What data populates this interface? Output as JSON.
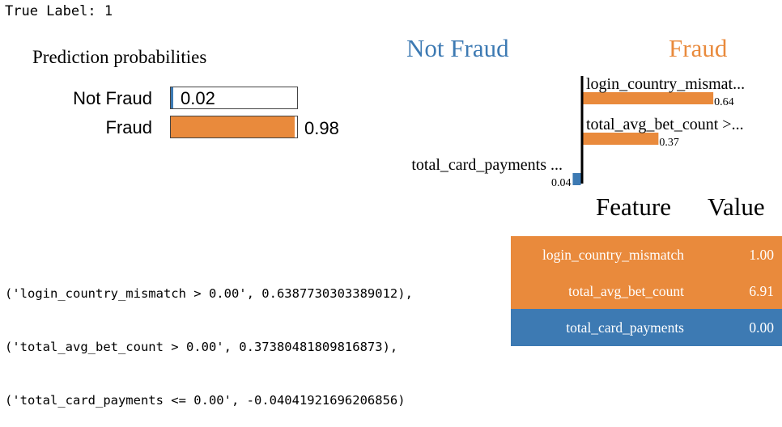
{
  "header": {
    "true_label": "True Label: 1"
  },
  "colors": {
    "not_fraud": "#3d7ab3",
    "fraud": "#e98a3c"
  },
  "prediction": {
    "title": "Prediction probabilities",
    "rows": [
      {
        "label": "Not Fraud",
        "value_text": "0.02",
        "value": 0.02,
        "color": "#3d7ab3"
      },
      {
        "label": "Fraud",
        "value_text": "0.98",
        "value": 0.98,
        "color": "#e98a3c"
      }
    ]
  },
  "chart_data": {
    "type": "bar",
    "orientation": "horizontal",
    "class_labels": {
      "negative": "Not Fraud",
      "positive": "Fraud"
    },
    "features": [
      {
        "label": "login_country_mismat...",
        "value": 0.64,
        "value_text": "0.64",
        "side": "positive"
      },
      {
        "label": "total_avg_bet_count >...",
        "value": 0.37,
        "value_text": "0.37",
        "side": "positive"
      },
      {
        "label": "total_card_payments ...",
        "value": -0.04,
        "value_text": "0.04",
        "side": "negative"
      }
    ]
  },
  "raw_explanation": [
    "('login_country_mismatch > 0.00', 0.6387730303389012),",
    "('total_avg_bet_count > 0.00', 0.37380481809816873),",
    "('total_card_payments <= 0.00', -0.04041921696206856)"
  ],
  "feature_table": {
    "headers": {
      "feature": "Feature",
      "value": "Value"
    },
    "rows": [
      {
        "feature": "login_country_mismatch",
        "value": "1.00",
        "color": "#e98a3c"
      },
      {
        "feature": "total_avg_bet_count",
        "value": "6.91",
        "color": "#e98a3c"
      },
      {
        "feature": "total_card_payments",
        "value": "0.00",
        "color": "#3d7ab3"
      }
    ]
  }
}
